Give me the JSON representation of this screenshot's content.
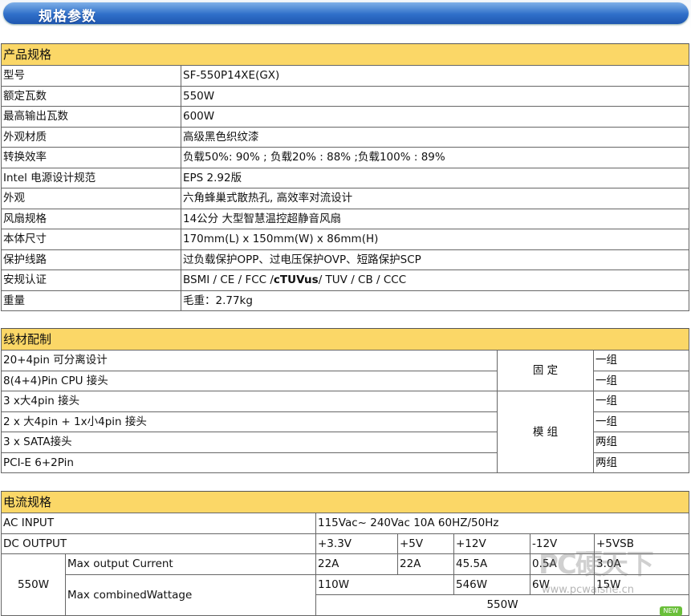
{
  "banner": {
    "title": "规格参数"
  },
  "spec": {
    "header": "产品规格",
    "rows": [
      {
        "label": "型号",
        "value": "SF-550P14XE(GX)"
      },
      {
        "label": "额定瓦数",
        "value": "550W"
      },
      {
        "label": "最高输出瓦数",
        "value": "600W"
      },
      {
        "label": "外观材质",
        "value": "高级黑色织纹漆"
      },
      {
        "label": "转换效率",
        "value": "负载50%: 90% ; 负载20% : 88% ;负载100% : 89%"
      },
      {
        "label": "Intel 电源设计规范",
        "value": "EPS 2.92版"
      },
      {
        "label": "外观",
        "value": "六角蜂巢式散热孔, 高效率对流设计"
      },
      {
        "label": "风扇规格",
        "value": "14公分 大型智慧温控超静音风扇"
      },
      {
        "label": "本体尺寸",
        "value": "170mm(L) x 150mm(W) x 86mm(H)"
      },
      {
        "label": "保护线路",
        "value": "过负载保护OPP、过电压保护OVP、短路保护SCP"
      },
      {
        "label": "安规认证",
        "value_pre": "BSMI / CE / FCC /",
        "value_bold": "cTUVus",
        "value_post": "/ TUV / CB / CCC"
      },
      {
        "label": "重量",
        "value": "毛重：2.77kg"
      }
    ]
  },
  "cables": {
    "header": "线材配制",
    "rows": [
      {
        "name": "20+4pin 可分离设计",
        "qty": "一组"
      },
      {
        "name": "8(4+4)Pin CPU 接头",
        "qty": "一组"
      },
      {
        "name": "3 x大4pin 接头",
        "qty": "一组"
      },
      {
        "name": "2 x 大4pin + 1x小4pin 接头",
        "qty": "一组"
      },
      {
        "name": "3 x SATA接头",
        "qty": "两组"
      },
      {
        "name": "PCI-E 6+2Pin",
        "qty": "两组"
      }
    ],
    "fixed_label": "固 定",
    "modular_label": "模 组"
  },
  "current": {
    "header": "电流规格",
    "ac_label": "AC INPUT",
    "ac_value": "115Vac~ 240Vac 10A 60HZ/50Hz",
    "dc_label": "DC OUTPUT",
    "rails": [
      "+3.3V",
      "+5V",
      "+12V",
      "-12V",
      "+5VSB"
    ],
    "model": "550W",
    "max_current_label": "Max output Current",
    "max_current": [
      "22A",
      "22A",
      "45.5A",
      "0.5A",
      "3.0A"
    ],
    "combined_label": "Max combinedWattage",
    "combined": [
      "110W",
      "",
      "546W",
      "6W",
      "15W"
    ],
    "total": "550W"
  },
  "watermark": {
    "logo": "PC硬天下",
    "url": "www.pcwaishe.cn",
    "badge": "NEW"
  }
}
